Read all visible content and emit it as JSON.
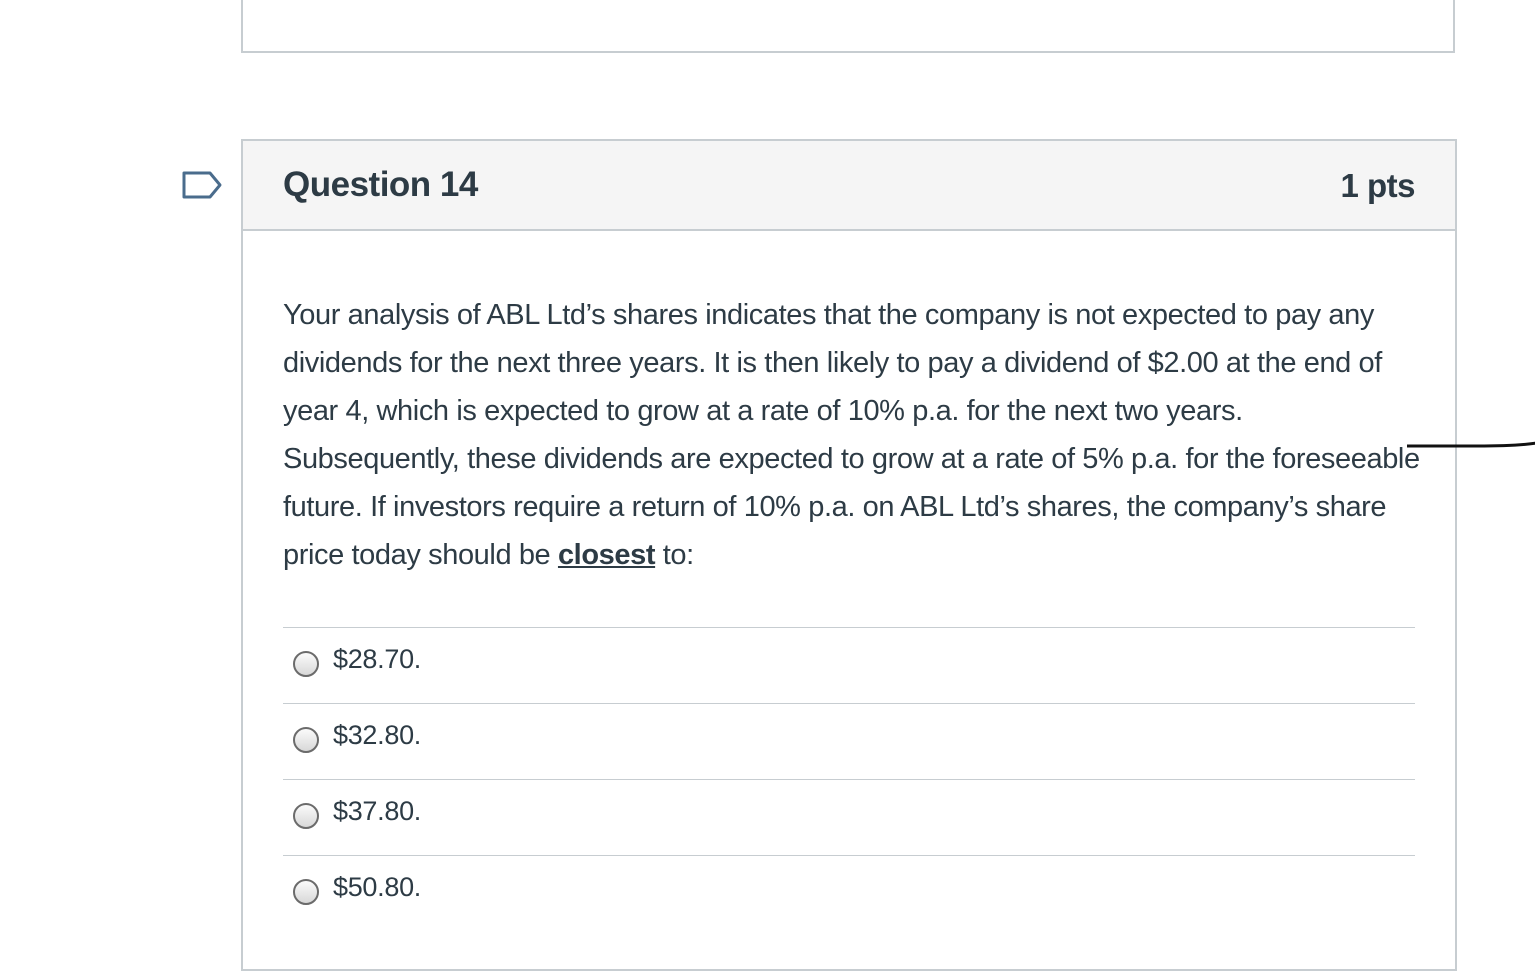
{
  "question": {
    "title": "Question 14",
    "points": "1 pts",
    "text_before": "Your analysis of ABL Ltd’s shares indicates that the company is not expected to pay any dividends for the next three years. It is then likely to pay a dividend of $2.00 at the end of year 4, which is expected to grow at a rate of 10% p.a. for the next two years. Subsequently, these dividends are expected to grow at a rate of 5% p.a. for the foreseeable future. If investors require a return of 10% p.a. on ABL Ltd’s shares, the company’s share price today should be ",
    "text_emphasis": "closest",
    "text_after": " to:"
  },
  "answers": [
    {
      "label": "$28.70."
    },
    {
      "label": "$32.80."
    },
    {
      "label": "$37.80."
    },
    {
      "label": "$50.80."
    }
  ],
  "icons": {
    "flag": "flag-question-icon"
  },
  "colors": {
    "text": "#2d3b45",
    "border": "#c7cdd1",
    "header_bg": "#f5f5f5"
  }
}
